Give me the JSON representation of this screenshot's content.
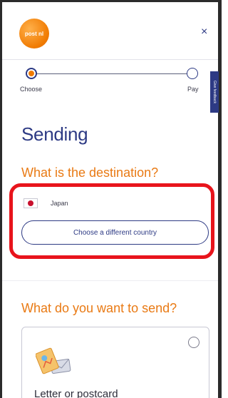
{
  "header": {
    "logo_text": "post nl",
    "close_label": "×"
  },
  "progress": {
    "steps": [
      {
        "label": "Choose",
        "active": true
      },
      {
        "label": "Pay",
        "active": false
      }
    ]
  },
  "side_tab": {
    "label": "Give feedback"
  },
  "page": {
    "title": "Sending"
  },
  "destination": {
    "heading": "What is the destination?",
    "country": "Japan",
    "change_button": "Choose a different country"
  },
  "send": {
    "heading": "What do you want to send?",
    "options": [
      {
        "label": "Letter or postcard",
        "selected": false
      }
    ]
  },
  "colors": {
    "brand_blue": "#2d3a84",
    "brand_orange": "#e97a14",
    "highlight_red": "#e8141c",
    "japan_red": "#c8102e"
  }
}
